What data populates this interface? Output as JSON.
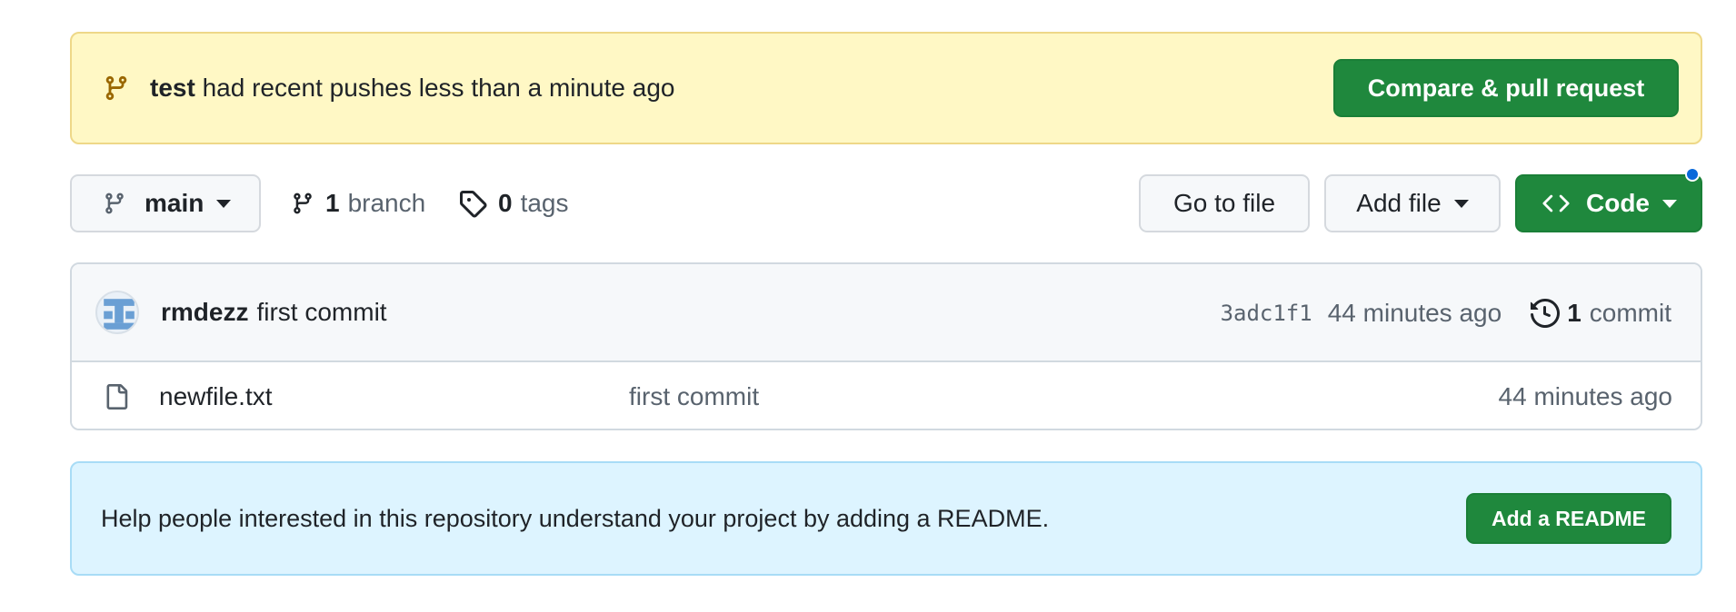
{
  "push_banner": {
    "branch": "test",
    "message": "had recent pushes less than a minute ago",
    "button_label": "Compare & pull request"
  },
  "toolbar": {
    "current_branch": "main",
    "branch_count": "1",
    "branch_label": "branch",
    "tag_count": "0",
    "tag_label": "tags",
    "go_to_file_label": "Go to file",
    "add_file_label": "Add file",
    "code_label": "Code"
  },
  "latest_commit": {
    "author": "rmdezz",
    "message": "first commit",
    "sha": "3adc1f1",
    "time": "44 minutes ago",
    "commit_count": "1",
    "commit_label": "commit"
  },
  "files": [
    {
      "name": "newfile.txt",
      "message": "first commit",
      "time": "44 minutes ago"
    }
  ],
  "readme_prompt": {
    "message": "Help people interested in this repository understand your project by adding a README.",
    "button_label": "Add a README"
  },
  "colors": {
    "primary_button": "#1f883d",
    "push_banner_bg": "#fff8c5",
    "readme_banner_bg": "#ddf4ff",
    "notification_dot": "#0969da"
  }
}
